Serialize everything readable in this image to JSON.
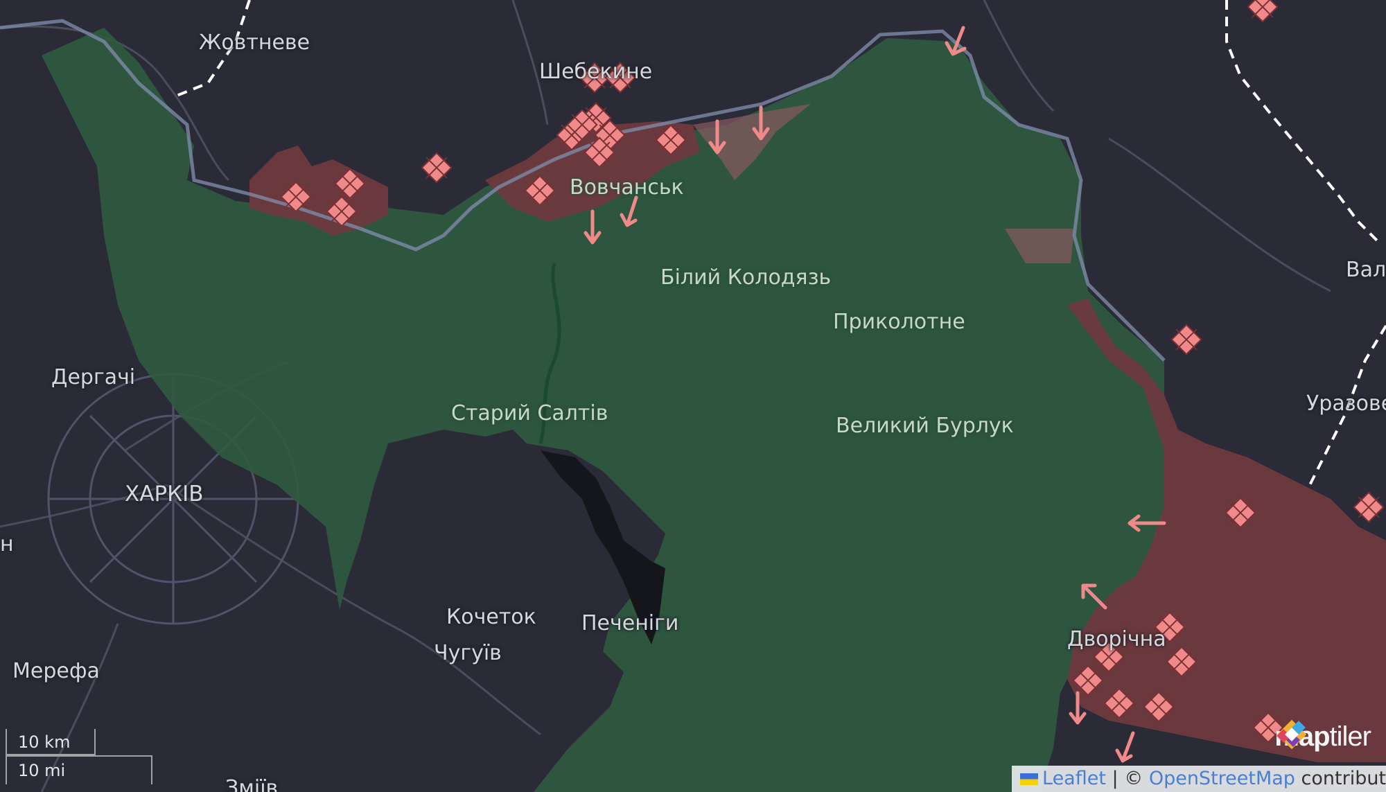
{
  "map": {
    "places": {
      "zhovtneve": "Жовтневе",
      "shebekino": "Шебекине",
      "vovchansk": "Вовчанськ",
      "bilyi_kolodiaz": "Білий Колодязь",
      "prykolotne": "Приколотне",
      "derhachi": "Дергачі",
      "staryi_saltiv": "Старий Салтів",
      "velykyi_burluk": "Великий Бурлук",
      "kharkiv": "ХАРКІВ",
      "kochetok": "Кочеток",
      "pechenihy": "Печеніги",
      "chuhuiv": "Чугуїв",
      "merefa": "Мерефа",
      "dvorichna": "Дворічна",
      "zmiiv": "Зміїв",
      "valuiky": "Вал",
      "urazove": "Уразове",
      "partial_left": "н"
    },
    "colors": {
      "liberated": "#2f5a40",
      "occupied": "#6e3a3e",
      "contested": "#8a5a5f",
      "marker": "#f08a8a",
      "background": "#2a2b36"
    },
    "markers": {
      "attack_icon": "diamond-grid-icon",
      "advance_icon": "arrow-icon"
    }
  },
  "scale": {
    "km": "10 km",
    "mi": "10 mi"
  },
  "attribution": {
    "leaflet": "Leaflet",
    "separator": "| ©",
    "osm": "OpenStreetMap",
    "contributors": "contributors"
  },
  "logo": {
    "brand_a": "map",
    "brand_b": "tiler"
  }
}
